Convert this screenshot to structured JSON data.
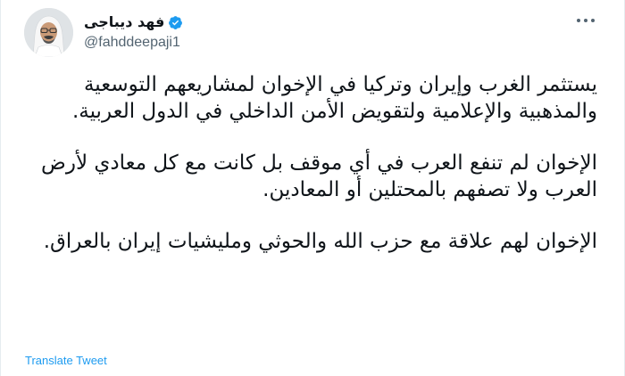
{
  "author": {
    "display_name": "فهد ديباجى",
    "handle": "@fahddeepaji1",
    "verified": true,
    "verified_color": "#1d9bf0",
    "avatar_icon": "profile-photo-man-in-white-ghutra"
  },
  "more_icon": "more-horizontal-icon",
  "tweet": {
    "paragraphs": [
      "يستثمر الغرب وإيران وتركيا في الإخوان لمشاريعهم التوسعية والمذهبية والإعلامية ولتقويض الأمن الداخلي في الدول العربية.",
      "الإخوان لم تنفع العرب في أي موقف بل كانت مع كل معادي لأرض العرب ولا تصفهم بالمحتلين أو المعادين.",
      "الإخوان لهم علاقة مع حزب الله والحوثي ومليشيات إيران بالعراق."
    ]
  },
  "translate_label": "Translate Tweet",
  "colors": {
    "text": "#0f1419",
    "secondary_text": "#536471",
    "link": "#1d9bf0",
    "border": "#e6ecf0"
  }
}
